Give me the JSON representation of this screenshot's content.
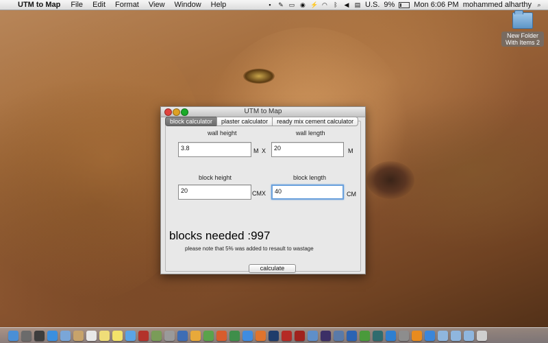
{
  "menubar": {
    "app_name": "UTM to Map",
    "items": [
      "File",
      "Edit",
      "Format",
      "View",
      "Window",
      "Help"
    ],
    "input_source": "U.S.",
    "battery": "9%",
    "clock": "Mon 6:06 PM",
    "user": "mohammed alharthy"
  },
  "desktop": {
    "folder_label": "New Folder With Items 2"
  },
  "window": {
    "title": "UTM to Map",
    "tabs": [
      {
        "label": "block calculator",
        "active": true
      },
      {
        "label": "plaster calculator",
        "active": false
      },
      {
        "label": "ready mix cement calculator",
        "active": false
      }
    ],
    "wall_height": {
      "label": "wall height",
      "value": "3.8",
      "unit": "M"
    },
    "wall_length": {
      "label": "wall length",
      "value": "20",
      "unit": "M"
    },
    "block_height": {
      "label": "block height",
      "value": "20",
      "unit": "CM"
    },
    "block_length": {
      "label": "block length",
      "value": "40",
      "unit": "CM"
    },
    "times_sign": "X",
    "result_text": "blocks needed :997",
    "note": "please note that 5% was added to resault to wastage",
    "calculate_label": "calculate"
  },
  "dock": {
    "icons": [
      {
        "name": "finder-icon",
        "color": "#4a8fd6"
      },
      {
        "name": "launchpad-icon",
        "color": "#6b6b6b"
      },
      {
        "name": "mission-control-icon",
        "color": "#3d3d3d"
      },
      {
        "name": "safari-icon",
        "color": "#3b8fe0"
      },
      {
        "name": "mail-icon",
        "color": "#7aa6d8"
      },
      {
        "name": "contacts-icon",
        "color": "#c7a36b"
      },
      {
        "name": "calendar-icon",
        "color": "#e8e8e8"
      },
      {
        "name": "notes-icon",
        "color": "#efdd78"
      },
      {
        "name": "stickies-icon",
        "color": "#f3e26a"
      },
      {
        "name": "itunes-icon",
        "color": "#5aa4e6"
      },
      {
        "name": "photobooth-icon",
        "color": "#b3322b"
      },
      {
        "name": "iphoto-icon",
        "color": "#7a9c58"
      },
      {
        "name": "preview-icon",
        "color": "#9a9a9a"
      },
      {
        "name": "word-icon",
        "color": "#3d6db5"
      },
      {
        "name": "outlook-icon",
        "color": "#e8a93a"
      },
      {
        "name": "messenger-icon",
        "color": "#5aa34b"
      },
      {
        "name": "powerpoint-icon",
        "color": "#d85c2c"
      },
      {
        "name": "excel-icon",
        "color": "#3f8e4a"
      },
      {
        "name": "chrome-icon",
        "color": "#3f8ce0"
      },
      {
        "name": "firefox-icon",
        "color": "#e0742c"
      },
      {
        "name": "photoshop-icon",
        "color": "#1f3d6b"
      },
      {
        "name": "flash-icon",
        "color": "#b52a25"
      },
      {
        "name": "flash-pro-icon",
        "color": "#a0221d"
      },
      {
        "name": "xcode-icon",
        "color": "#5f8fc9"
      },
      {
        "name": "after-effects-icon",
        "color": "#3c2f66"
      },
      {
        "name": "quicktime-icon",
        "color": "#5a7aa8"
      },
      {
        "name": "itunes-2-icon",
        "color": "#2b63b3"
      },
      {
        "name": "utorrent-icon",
        "color": "#4a9a3b"
      },
      {
        "name": "audition-icon",
        "color": "#2f6b6e"
      },
      {
        "name": "teamviewer-icon",
        "color": "#2f7fd0"
      },
      {
        "name": "system-prefs-icon",
        "color": "#8d8d8d"
      },
      {
        "name": "vlc-icon",
        "color": "#e88b1e"
      },
      {
        "name": "app-store-icon",
        "color": "#3b86d9"
      },
      {
        "name": "downloads-stack-icon",
        "color": "#8fb6de"
      },
      {
        "name": "documents-stack-icon",
        "color": "#8fb6de"
      },
      {
        "name": "applications-stack-icon",
        "color": "#8fb6de"
      },
      {
        "name": "trash-icon",
        "color": "#cfcfcf"
      }
    ]
  }
}
